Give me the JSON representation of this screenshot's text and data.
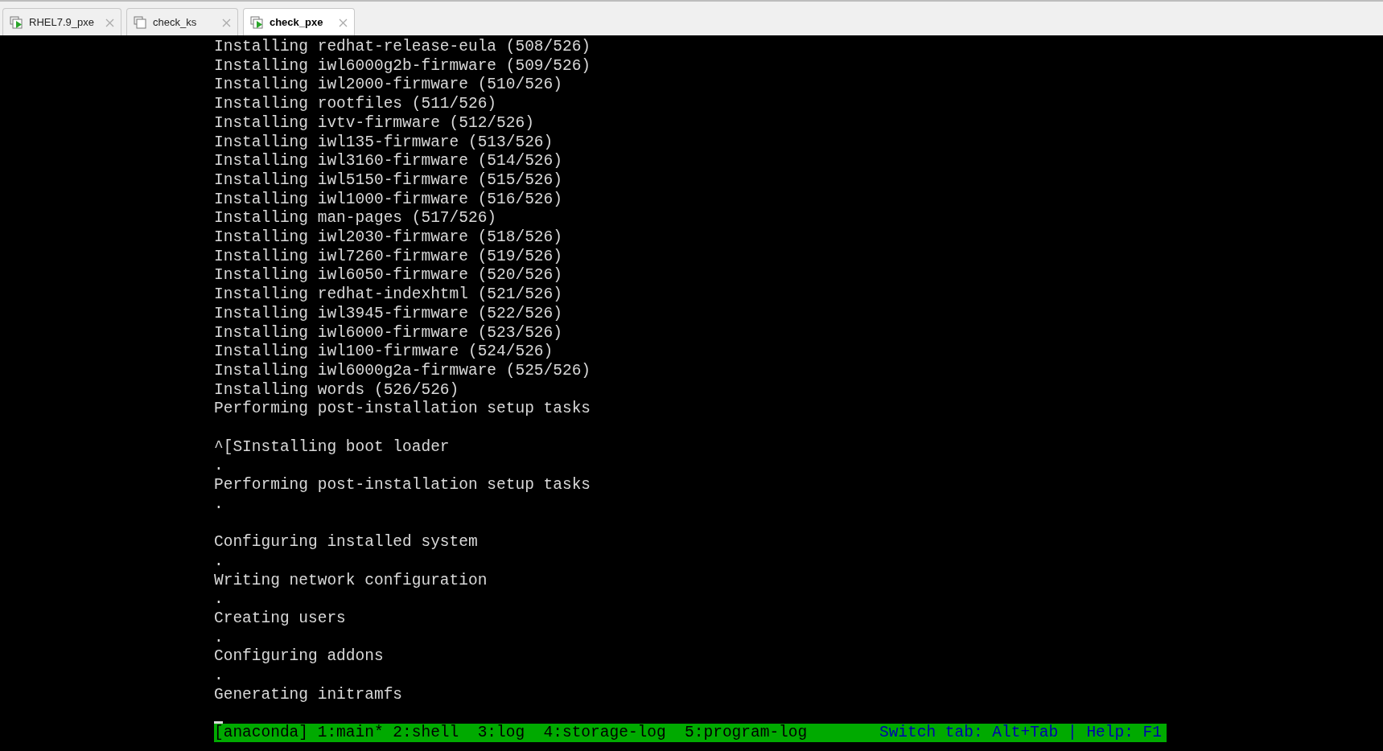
{
  "tabs": [
    {
      "label": "RHEL7.9_pxe",
      "running": true,
      "selected": false
    },
    {
      "label": "check_ks",
      "running": false,
      "selected": false
    },
    {
      "label": "check_pxe",
      "running": true,
      "selected": true
    }
  ],
  "console": {
    "blocks": [
      [
        "Installing redhat-release-eula (508/526)",
        "Installing iwl6000g2b-firmware (509/526)",
        "Installing iwl2000-firmware (510/526)",
        "Installing rootfiles (511/526)",
        "Installing ivtv-firmware (512/526)",
        "Installing iwl135-firmware (513/526)",
        "Installing iwl3160-firmware (514/526)",
        "Installing iwl5150-firmware (515/526)",
        "Installing iwl1000-firmware (516/526)",
        "Installing man-pages (517/526)",
        "Installing iwl2030-firmware (518/526)",
        "Installing iwl7260-firmware (519/526)",
        "Installing iwl6050-firmware (520/526)",
        "Installing redhat-indexhtml (521/526)",
        "Installing iwl3945-firmware (522/526)",
        "Installing iwl6000-firmware (523/526)",
        "Installing iwl100-firmware (524/526)",
        "Installing iwl6000g2a-firmware (525/526)",
        "Installing words (526/526)",
        "Performing post-installation setup tasks"
      ],
      [
        "^[SInstalling boot loader",
        ".",
        "Performing post-installation setup tasks",
        "."
      ],
      [
        "Configuring installed system",
        ".",
        "Writing network configuration",
        ".",
        "Creating users",
        ".",
        "Configuring addons",
        ".",
        "Generating initramfs"
      ]
    ],
    "status_bar": {
      "windows": "[anaconda] 1:main* 2:shell  3:log  4:storage-log  5:program-log",
      "hint": "Switch tab: Alt+Tab | Help: F1"
    }
  }
}
